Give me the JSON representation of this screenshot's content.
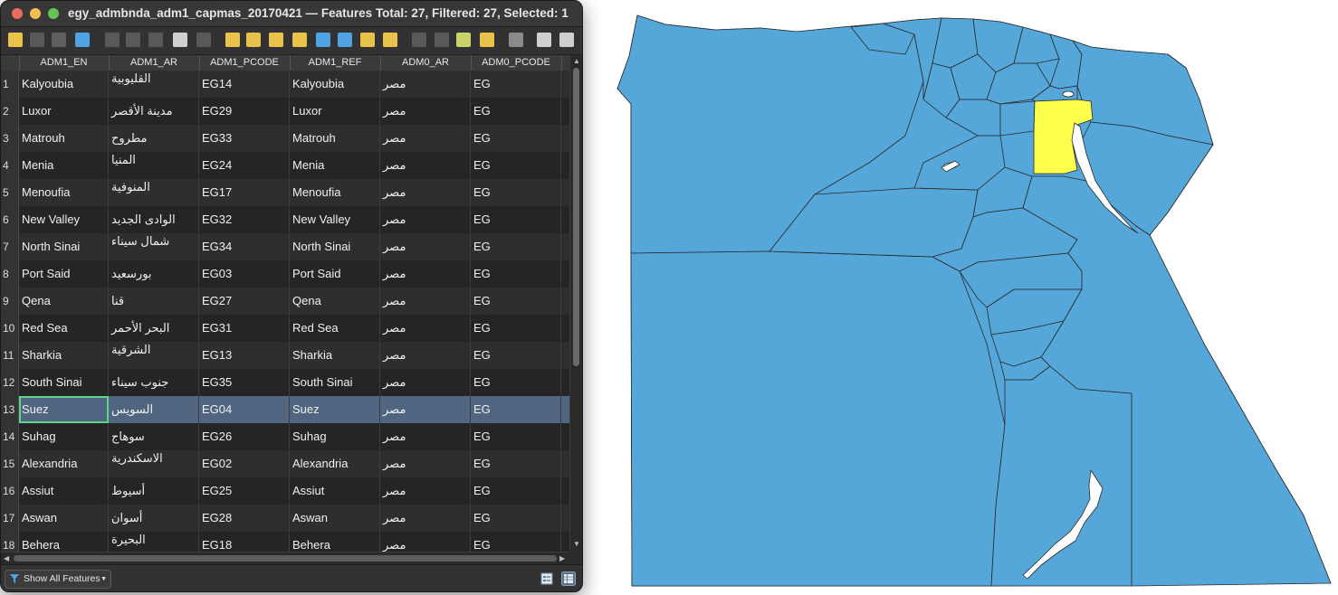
{
  "window": {
    "title": "egy_admbnda_adm1_capmas_20170421 — Features Total: 27, Filtered: 27, Selected: 1"
  },
  "toolbar": {
    "icons": [
      "toggle-editing-icon",
      "toggle-multi-edit-icon",
      "save-edits-icon",
      "reload-table-icon",
      "add-feature-icon",
      "delete-feature-icon",
      "cut-icon",
      "copy-icon",
      "paste-icon",
      "select-by-expression-icon",
      "select-all-icon",
      "invert-selection-icon",
      "deselect-all-icon",
      "filter-select-icon",
      "move-selection-to-top-icon",
      "pan-to-selection-icon",
      "zoom-to-selection-icon",
      "new-field-icon",
      "delete-field-icon",
      "field-calculator-icon",
      "conditional-formatting-icon",
      "actions-icon",
      "dock-icon",
      "more-options-icon"
    ]
  },
  "table": {
    "columns": [
      "ADM1_EN",
      "ADM1_AR",
      "ADM1_PCODE",
      "ADM1_REF",
      "ADM0_AR",
      "ADM0_PCODE"
    ],
    "selected_row": 13,
    "rows": [
      {
        "n": "1",
        "en": "Kalyoubia",
        "ar": "القليوبية",
        "pcode": "EG14",
        "ref": "Kalyoubia",
        "adm0_ar": "مصر",
        "adm0_pcode": "EG"
      },
      {
        "n": "2",
        "en": "Luxor",
        "ar": "مدينة الأقصر",
        "pcode": "EG29",
        "ref": "Luxor",
        "adm0_ar": "مصر",
        "adm0_pcode": "EG"
      },
      {
        "n": "3",
        "en": "Matrouh",
        "ar": "مطروح",
        "pcode": "EG33",
        "ref": "Matrouh",
        "adm0_ar": "مصر",
        "adm0_pcode": "EG"
      },
      {
        "n": "4",
        "en": "Menia",
        "ar": "المنيا",
        "pcode": "EG24",
        "ref": "Menia",
        "adm0_ar": "مصر",
        "adm0_pcode": "EG"
      },
      {
        "n": "5",
        "en": "Menoufia",
        "ar": "المنوفية",
        "pcode": "EG17",
        "ref": "Menoufia",
        "adm0_ar": "مصر",
        "adm0_pcode": "EG"
      },
      {
        "n": "6",
        "en": "New Valley",
        "ar": "الوادى الجديد",
        "pcode": "EG32",
        "ref": "New Valley",
        "adm0_ar": "مصر",
        "adm0_pcode": "EG"
      },
      {
        "n": "7",
        "en": "North Sinai",
        "ar": "شمال سيناء",
        "pcode": "EG34",
        "ref": "North Sinai",
        "adm0_ar": "مصر",
        "adm0_pcode": "EG"
      },
      {
        "n": "8",
        "en": "Port Said",
        "ar": "بورسعيد",
        "pcode": "EG03",
        "ref": "Port Said",
        "adm0_ar": "مصر",
        "adm0_pcode": "EG"
      },
      {
        "n": "9",
        "en": "Qena",
        "ar": "قنا",
        "pcode": "EG27",
        "ref": "Qena",
        "adm0_ar": "مصر",
        "adm0_pcode": "EG"
      },
      {
        "n": "10",
        "en": "Red Sea",
        "ar": "البحر الأحمر",
        "pcode": "EG31",
        "ref": "Red Sea",
        "adm0_ar": "مصر",
        "adm0_pcode": "EG"
      },
      {
        "n": "11",
        "en": "Sharkia",
        "ar": "الشرقية",
        "pcode": "EG13",
        "ref": "Sharkia",
        "adm0_ar": "مصر",
        "adm0_pcode": "EG"
      },
      {
        "n": "12",
        "en": "South Sinai",
        "ar": "جنوب سيناء",
        "pcode": "EG35",
        "ref": "South Sinai",
        "adm0_ar": "مصر",
        "adm0_pcode": "EG"
      },
      {
        "n": "13",
        "en": "Suez",
        "ar": "السويس",
        "pcode": "EG04",
        "ref": "Suez",
        "adm0_ar": "مصر",
        "adm0_pcode": "EG"
      },
      {
        "n": "14",
        "en": "Suhag",
        "ar": "سوهاج",
        "pcode": "EG26",
        "ref": "Suhag",
        "adm0_ar": "مصر",
        "adm0_pcode": "EG"
      },
      {
        "n": "15",
        "en": "Alexandria",
        "ar": "الاسكندرية",
        "pcode": "EG02",
        "ref": "Alexandria",
        "adm0_ar": "مصر",
        "adm0_pcode": "EG"
      },
      {
        "n": "16",
        "en": "Assiut",
        "ar": "أسيوط",
        "pcode": "EG25",
        "ref": "Assiut",
        "adm0_ar": "مصر",
        "adm0_pcode": "EG"
      },
      {
        "n": "17",
        "en": "Aswan",
        "ar": "أسوان",
        "pcode": "EG28",
        "ref": "Aswan",
        "adm0_ar": "مصر",
        "adm0_pcode": "EG"
      },
      {
        "n": "18",
        "en": "Behera",
        "ar": "البحيرة",
        "pcode": "EG18",
        "ref": "Behera",
        "adm0_ar": "مصر",
        "adm0_pcode": "EG"
      }
    ]
  },
  "footer": {
    "filter_label": "Show All Features",
    "form_view_icon": "form-view-icon",
    "table_view_icon": "table-view-icon"
  },
  "map": {
    "fill_color": "#55a6d9",
    "selected_color": "#ffff4d",
    "stroke_color": "#2a2a2a",
    "selected_feature": "Suez"
  }
}
